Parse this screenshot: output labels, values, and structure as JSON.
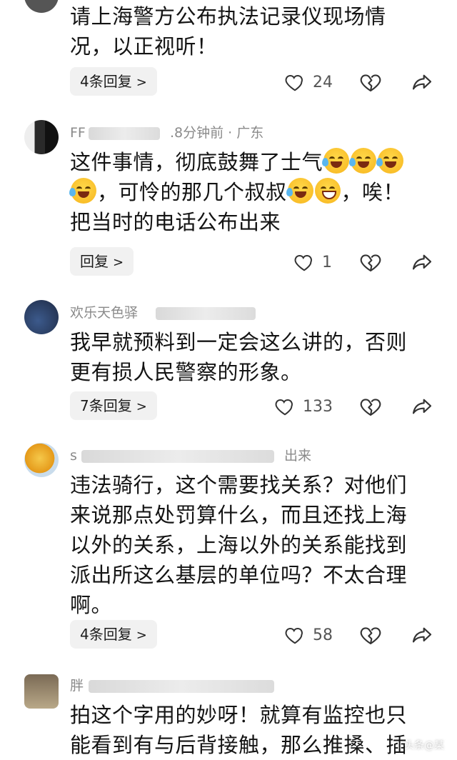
{
  "comments": [
    {
      "user": "",
      "meta": "",
      "text_lines": [
        "请上海警方公布执法记录仪现场情",
        "况，以正视听！"
      ],
      "reply_label": "4条回复",
      "likes": "24"
    },
    {
      "user": "FF",
      "meta": ".8分钟前 · 广东",
      "text_line1": "这件事情，彻底鼓舞了士气",
      "text_line2_a": "，可怜的那几个叔叔",
      "text_line2_b": "，唉！",
      "text_line3": "把当时的电话公布出来",
      "reply_label": "回复",
      "likes": "1"
    },
    {
      "user": "欢乐天色驿",
      "meta": "",
      "text_lines": [
        "我早就预料到一定会这么讲的，否则",
        "更有损人民警察的形象。"
      ],
      "reply_label": "7条回复",
      "likes": "133"
    },
    {
      "user": "s",
      "meta": "出来",
      "text_lines": [
        "违法骑行，这个需要找关系？对他们",
        "来说那点处罚算什么，而且还找上海",
        "以外的关系，上海以外的关系能找到",
        "派出所这么基层的单位吗？不太合理",
        "啊。"
      ],
      "reply_label": "4条回复",
      "likes": "58"
    },
    {
      "user": "胖",
      "meta": "",
      "text_lines": [
        "拍这个字用的妙呀！就算有监控也只",
        "能看到有与后背接触，那么推搡、插"
      ],
      "reply_label": "",
      "likes": ""
    }
  ],
  "icons": {
    "like": "heart-outline-icon",
    "dislike": "broken-heart-icon",
    "share": "share-arrow-icon",
    "emoji_cry": "laughing-crying-emoji",
    "emoji_grin": "grinning-emoji"
  },
  "watermark": "头条@某"
}
